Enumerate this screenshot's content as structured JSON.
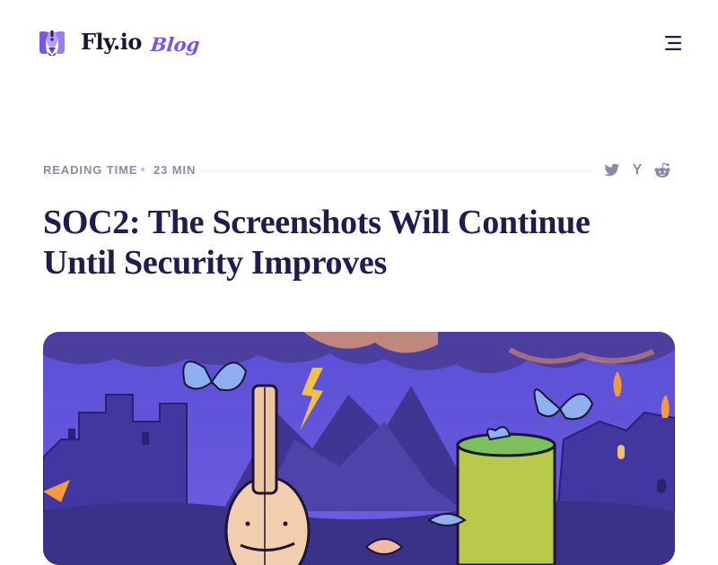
{
  "header": {
    "brand_name": "Fly.io",
    "brand_sub": "Blog"
  },
  "meta": {
    "reading_label": "READING TIME",
    "reading_value": "23 MIN",
    "share": [
      "twitter-icon",
      "hacker-news-icon",
      "reddit-icon"
    ],
    "hn_glyph": "Y"
  },
  "post": {
    "title": "SOC2: The Screenshots Will Continue Until Security Improves"
  },
  "colors": {
    "brand_purple": "#7a55e6",
    "title_ink": "#241a4d",
    "muted": "#8e88a6"
  }
}
